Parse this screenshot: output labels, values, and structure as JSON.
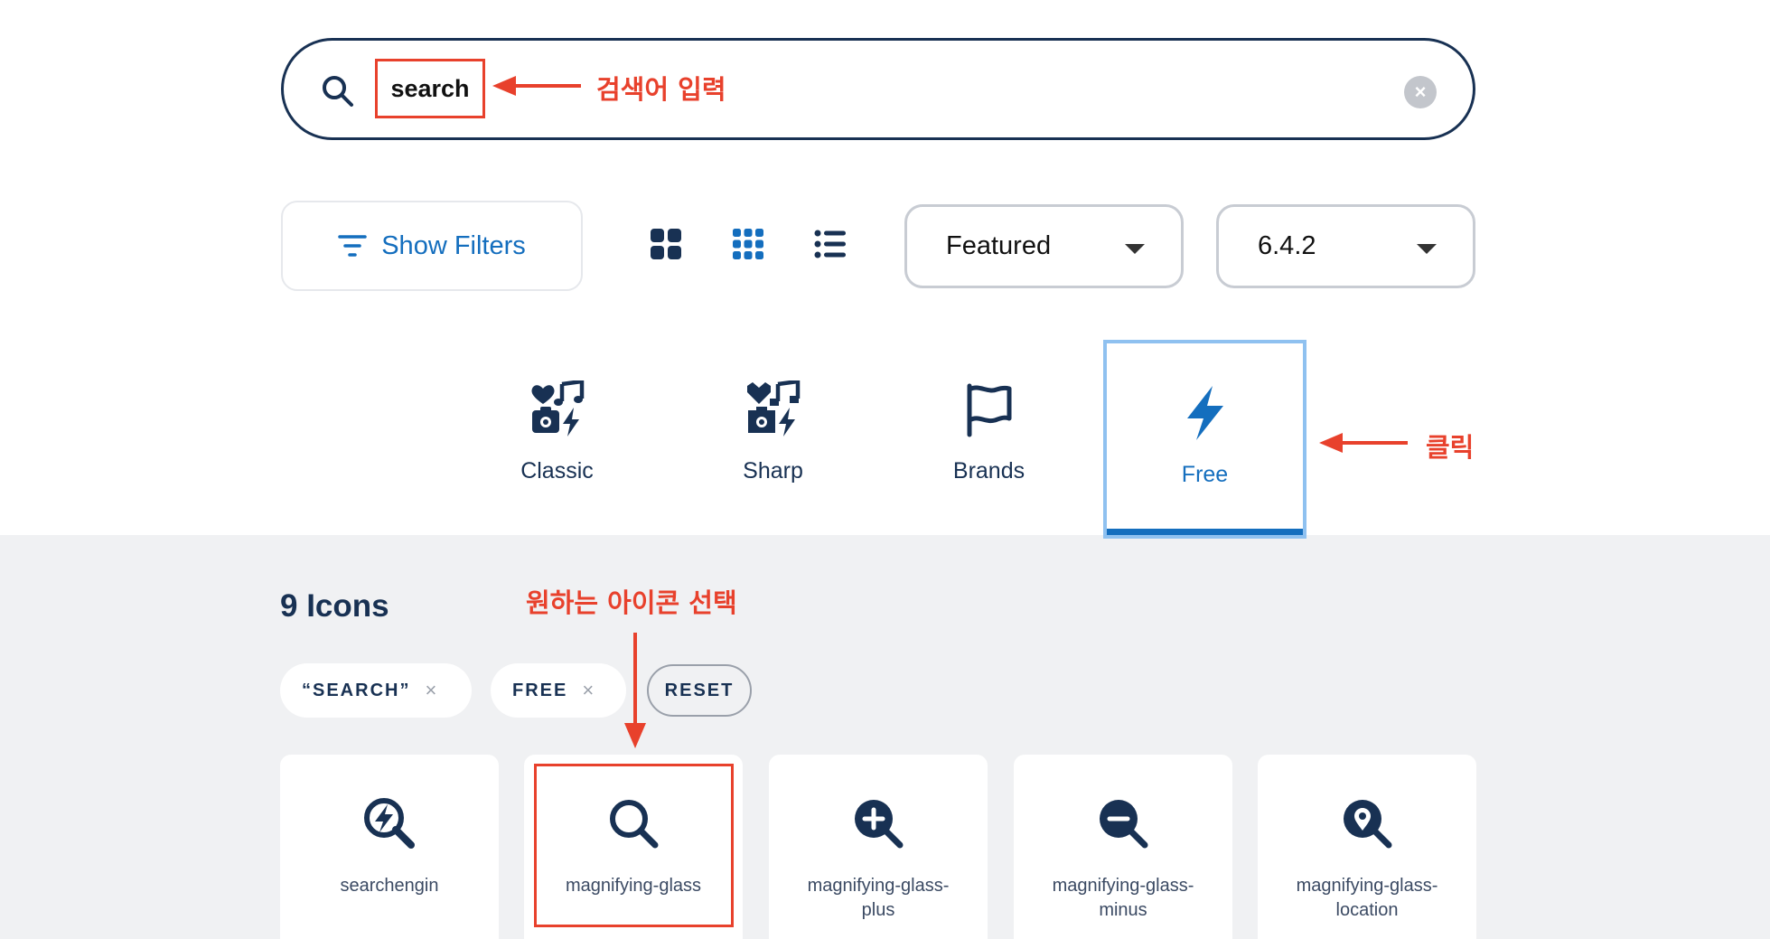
{
  "search": {
    "value": "search",
    "clear_label": "×"
  },
  "annotations": {
    "search_note": "검색어 입력",
    "click_note": "클릭",
    "select_note": "원하는 아이콘 선택"
  },
  "controls": {
    "show_filters_label": "Show Filters",
    "view_modes": [
      "large-grid",
      "small-grid",
      "list"
    ],
    "sort_value": "Featured",
    "version_value": "6.4.2"
  },
  "families": [
    {
      "label": "Classic",
      "icon": "classic-family-icon"
    },
    {
      "label": "Sharp",
      "icon": "sharp-family-icon"
    },
    {
      "label": "Brands",
      "icon": "flag-icon"
    },
    {
      "label": "Free",
      "icon": "bolt-icon",
      "active": true
    }
  ],
  "results": {
    "count_label": "9 Icons",
    "chips": [
      {
        "label": "“SEARCH”",
        "remove": "×"
      },
      {
        "label": "FREE",
        "remove": "×"
      }
    ],
    "reset_label": "RESET",
    "icons": [
      {
        "name": "searchengin",
        "icon": "searchengin-icon"
      },
      {
        "name": "magnifying-glass",
        "icon": "magnifying-glass-icon",
        "selected": true
      },
      {
        "name": "magnifying-glass-\nplus",
        "icon": "magnifying-glass-plus-icon"
      },
      {
        "name": "magnifying-glass-\nminus",
        "icon": "magnifying-glass-minus-icon"
      },
      {
        "name": "magnifying-glass-\nlocation",
        "icon": "magnifying-glass-location-icon"
      }
    ]
  },
  "colors": {
    "navy": "#183153",
    "blue": "#146ebe",
    "annotation_red": "#e8412c",
    "panel_gray": "#f0f1f3"
  }
}
